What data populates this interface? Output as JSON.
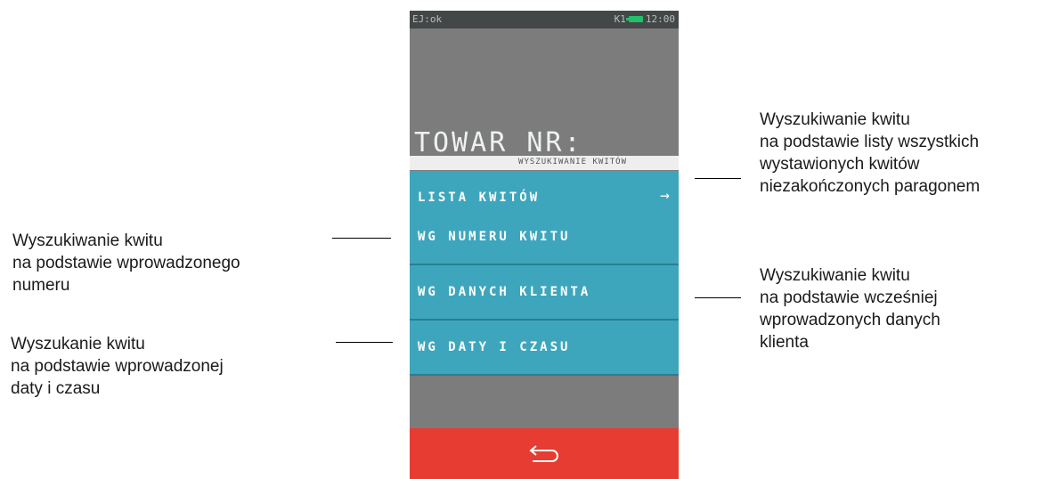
{
  "device": {
    "status_left": "EJ:ok",
    "status_k": "K1",
    "status_time": "12:00",
    "product_prompt": "TOWAR NR:",
    "section_header": "WYSZUKIWANIE KWITÓW",
    "menu": [
      {
        "label": "LISTA KWITÓW",
        "arrow": "→"
      },
      {
        "label": "WG NUMERU KWITU"
      },
      {
        "label": "WG DANYCH KLIENTA"
      },
      {
        "label": "WG DATY I CZASU"
      }
    ]
  },
  "annotations": {
    "right_1": [
      "Wyszukiwanie kwitu",
      "na podstawie listy wszystkich",
      "wystawionych kwitów",
      "niezakończonych paragonem"
    ],
    "left_1": [
      "Wyszukiwanie kwitu",
      "na podstawie wprowadzonego",
      "numeru"
    ],
    "right_2": [
      "Wyszukiwanie kwitu",
      "na podstawie wcześniej",
      "wprowadzonych danych",
      "klienta"
    ],
    "left_2": [
      "Wyszukanie kwitu",
      "na podstawie wprowadzonej",
      "daty i czasu"
    ]
  },
  "colors": {
    "menu_bg": "#3da6bd",
    "back_bar": "#e63c32",
    "screen_bg": "#7c7c7c"
  }
}
